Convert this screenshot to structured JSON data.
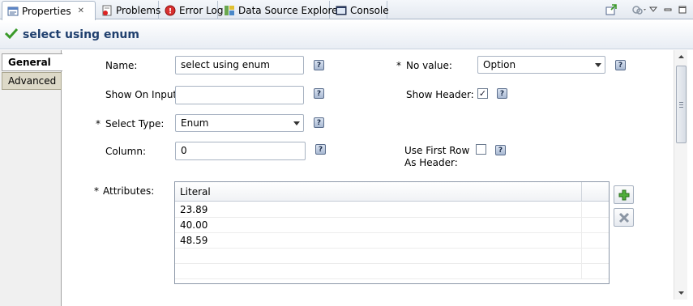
{
  "tabs": [
    {
      "label": "Properties",
      "icon": "properties-icon",
      "active": true
    },
    {
      "label": "Problems",
      "icon": "problems-icon"
    },
    {
      "label": "Error Log",
      "icon": "error-log-icon"
    },
    {
      "label": "Data Source Explorer",
      "icon": "data-source-icon"
    },
    {
      "label": "Console",
      "icon": "console-icon"
    }
  ],
  "close_glyph": "✕",
  "title": "select using enum",
  "side_tabs": {
    "general": "General",
    "advanced": "Advanced"
  },
  "required_mark": "*",
  "help_glyph": "?",
  "form": {
    "name_label": "Name:",
    "name_value": "select using enum",
    "show_on_input_label": "Show On Input:",
    "show_on_input_value": "",
    "select_type_label": "Select Type:",
    "select_type_value": "Enum",
    "column_label": "Column:",
    "column_value": "0",
    "no_value_label": "No value:",
    "no_value_value": "Option",
    "show_header_label": "Show Header:",
    "show_header_checked": true,
    "use_first_row_label_1": "Use First Row",
    "use_first_row_label_2": "As Header:",
    "use_first_row_checked": false,
    "attributes_label": "Attributes:"
  },
  "table": {
    "header": "Literal",
    "rows": [
      "23.89",
      "40.00",
      "48.59"
    ]
  },
  "checkmark": "✓",
  "colors": {
    "accent": "#1f3f6e",
    "add_green": "#3c9a2a",
    "remove_gray": "#8a95a3"
  }
}
